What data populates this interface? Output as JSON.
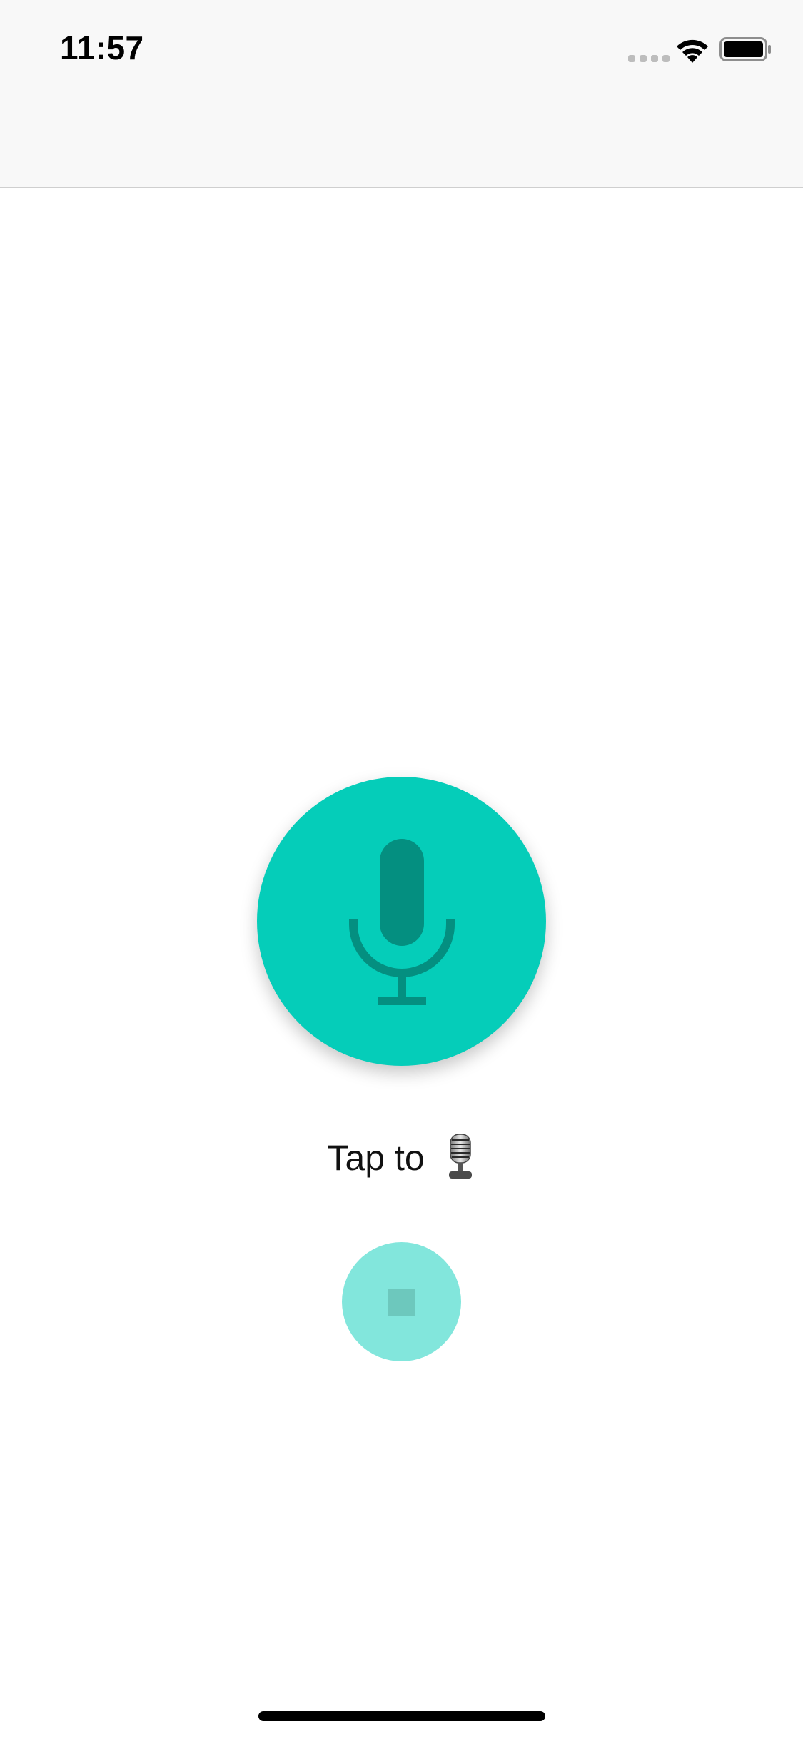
{
  "status_bar": {
    "time": "11:57",
    "signal_icon": "cellular-signal-dots-icon",
    "wifi_icon": "wifi-icon",
    "battery_icon": "battery-icon"
  },
  "main": {
    "record_button_icon": "microphone-icon",
    "prompt": {
      "text": "Tap to",
      "emoji": "studio-microphone-emoji"
    },
    "stop_button_icon": "stop-icon"
  },
  "colors": {
    "accent": "#05cdb9",
    "accent_dark": "#048f80",
    "accent_light": "#82e6dc",
    "nav_background": "#f8f8f8"
  }
}
